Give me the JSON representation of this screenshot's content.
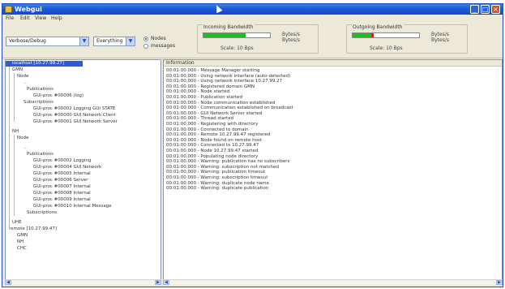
{
  "app": {
    "title": "Webgui"
  },
  "menu": [
    "File",
    "Edit",
    "View",
    "Help"
  ],
  "toolbar": {
    "loglevel_select": "Verbose/Debug",
    "filter_select": "Everything",
    "radio_a": "Nodes",
    "radio_b": "messages",
    "incoming": {
      "label": "Incoming Bandwidth",
      "text1": "Bytes/s",
      "text2": "Bytes/s",
      "value_fraction": 0.63,
      "scale": "Scale: 10 Bps"
    },
    "outgoing": {
      "label": "Outgoing Bandwidth",
      "text1": "Bytes/s",
      "text2": "Bytes/s",
      "value_fraction": 0.28,
      "scale": "Scale: 10 Bps"
    }
  },
  "tree": {
    "root": "localhost [10.27.99.27]",
    "rows": [
      "GMN",
      "Node",
      "...",
      "Publications",
      "GUI-proc #00006 (log)",
      "Subscriptions",
      "GUI-proc #00002 Logging GUI STATE",
      "GUI-proc #00000 GUI Network Client",
      "GUI-proc #00001 GUI Network Server",
      "NH",
      "Node",
      "...",
      "Publications",
      "GUI-proc #00002 Logging",
      "GUI-proc #00004 GUI Network",
      "GUI-proc #00005 Internal",
      "GUI-proc #00006 Server",
      "GUI-proc #00007 Internal",
      "GUI-proc #00008 Internal",
      "GUI-proc #00009 Internal",
      "GUI-proc #00010 Internal Message",
      "Subscriptions",
      "UHE",
      "remote [10.27.99.47]",
      "GMN",
      "NH",
      "CHC"
    ]
  },
  "log": {
    "header": "Information",
    "lines": [
      "00:01:00.000 - Message Manager starting",
      "00:01:00.000 - Using network interface (auto-detected)",
      "00:01:00.000 - Using network interface 10.27.99.27",
      "00:01:00.000 - Registered domain GMN",
      "00:01:00.000 - Node started",
      "00:01:00.000 - Publication started",
      "00:01:00.000 - Node communication established",
      "00:01:00.000 - Communication established on broadcast",
      "00:01:00.000 - GUI Network Server started",
      "00:01:00.000 - Thread started",
      "00:01:00.000 - Registering with directory",
      "00:01:00.000 - Connected to domain",
      "00:01:00.000 - Remote 10.27.99.47 registered",
      "00:01:00.000 - Node found on remote host",
      "00:01:00.000 - Connected to 10.27.99.47",
      "00:01:00.000 - Node 10.27.99.47 started",
      "00:01:00.000 - Populating node directory",
      "00:01:00.000 - Warning: publication has no subscribers",
      "00:01:00.000 - Warning: subscription not matched",
      "00:01:00.000 - Warning: publication timeout",
      "00:01:00.000 - Warning: subscription timeout",
      "00:01:00.000 - Warning: duplicate node name",
      "00:01:00.000 - Warning: duplicate publication"
    ]
  },
  "colors": {
    "title_bar": "#1c5ad8",
    "selection": "#2b5bd7",
    "bar_fill": "#16c416",
    "bar_mark": "#d42020"
  }
}
